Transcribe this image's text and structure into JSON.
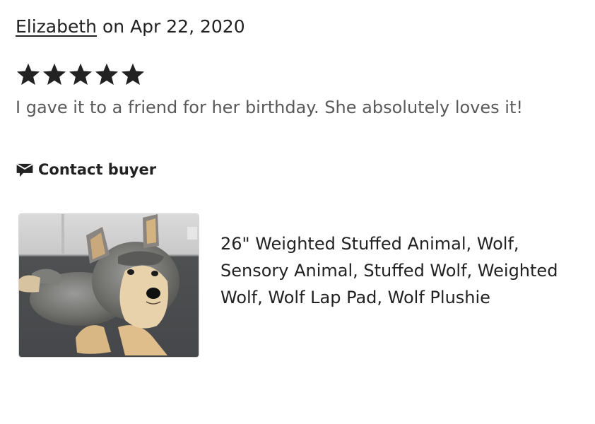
{
  "review": {
    "reviewer": "Elizabeth",
    "date_prefix": " on ",
    "date": "Apr 22, 2020",
    "rating": 5,
    "rating_max": 5,
    "text": "I gave it to a friend for her birthday. She absolutely loves it!"
  },
  "contact": {
    "label": "Contact buyer",
    "icon": "message-icon"
  },
  "product": {
    "title": "26\" Weighted Stuffed Animal, Wolf, Sensory Animal, Stuffed Wolf, Weighted Wolf, Wolf Lap Pad, Wolf Plushie",
    "image_icon": "wolf-plush-photo"
  },
  "colors": {
    "text": "#222222",
    "muted_text": "#595959",
    "star": "#222222"
  }
}
